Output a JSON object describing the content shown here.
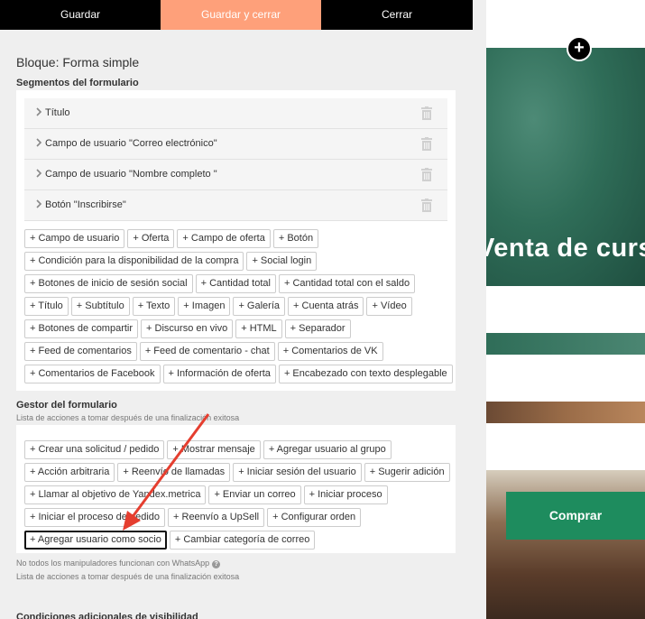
{
  "topbar": {
    "save_label": "Guardar",
    "save_close_label": "Guardar y cerrar",
    "close_label": "Cerrar"
  },
  "block_title": "Bloque: Forma simple",
  "segments_section": {
    "title": "Segmentos del formulario",
    "items": [
      {
        "label": "Título"
      },
      {
        "label": "Campo de usuario \"Correo electrónico\""
      },
      {
        "label": "Campo de usuario \"Nombre completo \""
      },
      {
        "label": "Botón \"Inscribirse\""
      }
    ],
    "add_chips": [
      [
        "+ Campo de usuario",
        "+ Oferta",
        "+ Campo de oferta",
        "+ Botón"
      ],
      [
        "+ Condición para la disponibilidad de la compra",
        "+ Social login"
      ],
      [
        "+ Botones de inicio de sesión social",
        "+ Cantidad total",
        "+ Cantidad total con el saldo"
      ],
      [
        "+ Título",
        "+ Subtítulo",
        "+ Texto",
        "+ Imagen",
        "+ Galería",
        "+ Cuenta atrás",
        "+ Vídeo"
      ],
      [
        "+ Botones de compartir",
        "+ Discurso en vivo",
        "+ HTML",
        "+ Separador"
      ],
      [
        "+ Feed de comentarios",
        "+ Feed de comentario - chat",
        "+ Comentarios de VK"
      ],
      [
        "+ Comentarios de Facebook",
        "+ Información de oferta",
        "+ Encabezado con texto desplegable"
      ]
    ]
  },
  "handler_section": {
    "title": "Gestor del formulario",
    "subtitle": "Lista de acciones a tomar después de una finalización exitosa",
    "chips": [
      [
        "+ Crear una solicitud / pedido",
        "+ Mostrar mensaje",
        "+ Agregar usuario al grupo"
      ],
      [
        "+ Acción arbitraria",
        "+ Reenvío de llamadas",
        "+ Iniciar sesión del usuario",
        "+ Sugerir adición"
      ],
      [
        "+ Llamar al objetivo de Yandex.metrica",
        "+ Enviar un correo",
        "+ Iniciar proceso"
      ],
      [
        "+ Iniciar el proceso de pedido",
        "+ Reenvío a UpSell",
        "+ Configurar orden"
      ],
      [
        "+ Agregar usuario como socio",
        "+ Cambiar categoría de correo"
      ]
    ],
    "highlighted": "+ Agregar usuario como socio",
    "note": "No todos los manipuladores funcionan con WhatsApp",
    "note2": "Lista de acciones a tomar después de una finalización exitosa"
  },
  "cutoff_text": "Condiciones adicionales de visibilidad",
  "preview": {
    "hero_text": "Venta de curs",
    "buy_label": "Comprar",
    "add_symbol": "+"
  },
  "colors": {
    "accent": "#fea07a",
    "dark": "#000000",
    "buy_green": "#1e8c5e",
    "arrow_red": "#e53e2f"
  },
  "icons": [
    "chevron-right-icon",
    "trash-icon",
    "help-icon",
    "plus-icon",
    "arrow-annotation"
  ]
}
